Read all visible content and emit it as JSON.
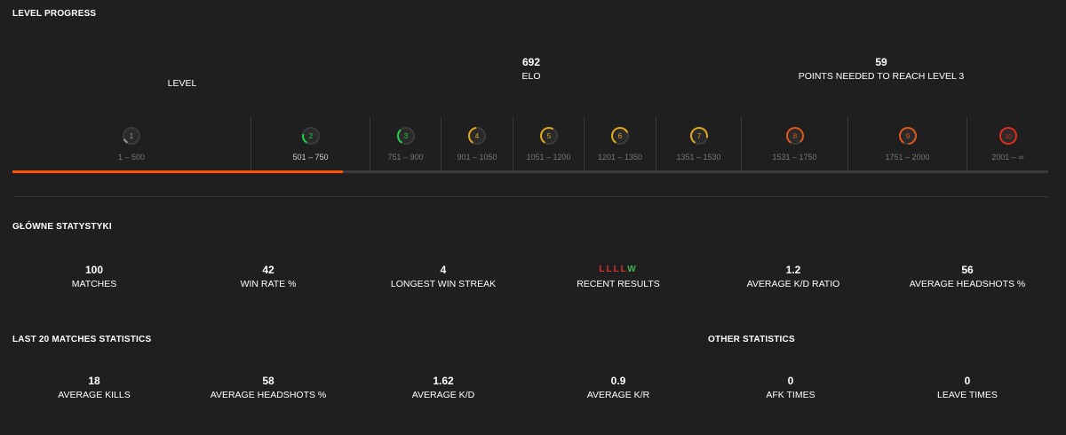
{
  "level_progress": {
    "title": "LEVEL PROGRESS",
    "level_label": "LEVEL",
    "elo_value": "692",
    "elo_label": "ELO",
    "points_needed_value": "59",
    "points_needed_label": "POINTS NEEDED TO REACH LEVEL 3",
    "current_level": 2,
    "progress_fraction": 0.319,
    "levels": [
      {
        "number": "1",
        "range": "1 – 500",
        "color": "#9a9a9a"
      },
      {
        "number": "2",
        "range": "501 – 750",
        "color": "#1fd24a"
      },
      {
        "number": "3",
        "range": "751 – 900",
        "color": "#1fd24a"
      },
      {
        "number": "4",
        "range": "901 – 1050",
        "color": "#e0a81a"
      },
      {
        "number": "5",
        "range": "1051 – 1200",
        "color": "#e0a81a"
      },
      {
        "number": "6",
        "range": "1201 – 1350",
        "color": "#e0a81a"
      },
      {
        "number": "7",
        "range": "1351 – 1530",
        "color": "#e0a81a"
      },
      {
        "number": "8",
        "range": "1531 – 1750",
        "color": "#e0551a"
      },
      {
        "number": "9",
        "range": "1751 – 2000",
        "color": "#e0551a"
      },
      {
        "number": "10",
        "range": "2001 – ∞",
        "color": "#e02a1a"
      }
    ],
    "accent_color": "#ff5500"
  },
  "main_stats": {
    "title": "GŁÓWNE STATYSTYKI",
    "items": [
      {
        "value": "100",
        "label": "MATCHES"
      },
      {
        "value": "42",
        "label": "WIN RATE %"
      },
      {
        "value": "4",
        "label": "LONGEST WIN STREAK"
      },
      {
        "value": "",
        "label": "RECENT RESULTS"
      },
      {
        "value": "1.2",
        "label": "AVERAGE K/D RATIO"
      },
      {
        "value": "56",
        "label": "AVERAGE HEADSHOTS %"
      }
    ],
    "recent_results": [
      "L",
      "L",
      "L",
      "L",
      "W"
    ]
  },
  "last20": {
    "title": "LAST 20 MATCHES STATISTICS",
    "items": [
      {
        "value": "18",
        "label": "AVERAGE KILLS"
      },
      {
        "value": "58",
        "label": "AVERAGE HEADSHOTS %"
      },
      {
        "value": "1.62",
        "label": "AVERAGE K/D"
      },
      {
        "value": "0.9",
        "label": "AVERAGE K/R"
      }
    ]
  },
  "other": {
    "title": "OTHER STATISTICS",
    "items": [
      {
        "value": "0",
        "label": "AFK TIMES"
      },
      {
        "value": "0",
        "label": "LEAVE TIMES"
      }
    ]
  }
}
